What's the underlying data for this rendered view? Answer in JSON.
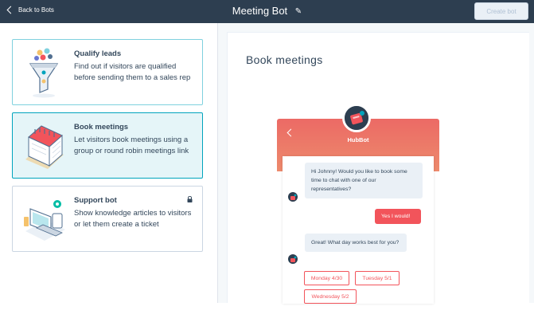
{
  "topbar": {
    "back_label": "Back to Bots",
    "title": "Meeting Bot",
    "pencil_icon": "pencil-icon",
    "create_label": "Create bot"
  },
  "cards": [
    {
      "title": "Qualify leads",
      "description": "Find out if visitors are qualified before sending them to a sales rep",
      "illustration": "funnel-illustration",
      "selected": false
    },
    {
      "title": "Book meetings",
      "description": "Let visitors book meetings using a group or round robin meetings link",
      "illustration": "calendar-illustration",
      "selected": true
    },
    {
      "title": "Support bot",
      "description": "Show knowledge articles to visitors or let them create a ticket",
      "illustration": "devices-illustration",
      "selected": false,
      "locked": true
    }
  ],
  "preview": {
    "title": "Book meetings",
    "bot_name": "HubBot",
    "messages": {
      "bot1": "Hi Johnny! Would you like to book some time to chat with one of our representatives?",
      "user1": "Yes I would!",
      "bot2": "Great!  What day works best for you?"
    },
    "options": [
      "Monday 4/30",
      "Tuesday 5/1",
      "Wednesday 5/2"
    ]
  },
  "colors": {
    "topbar": "#2d3e50",
    "accent_teal": "#00a4bd",
    "selected_bg": "#e5f5f8",
    "widget_header": "#ec6a65",
    "reply": "#f2545b"
  }
}
